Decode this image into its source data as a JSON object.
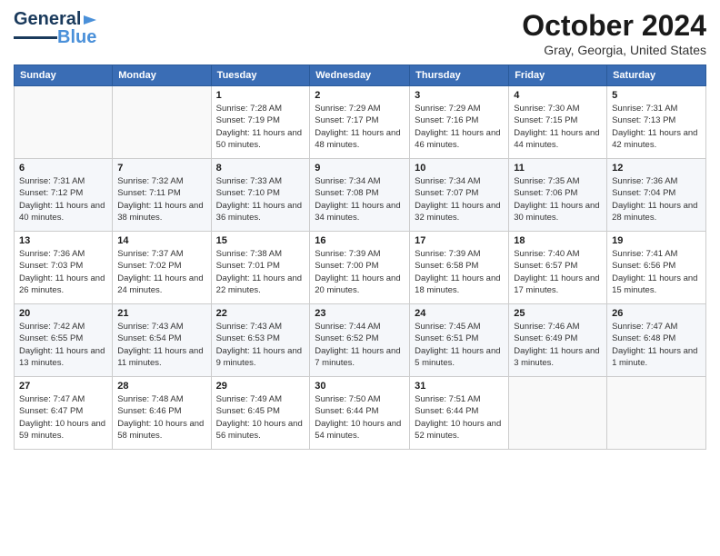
{
  "header": {
    "logo": {
      "line1": "General",
      "line2": "Blue"
    },
    "title": "October 2024",
    "location": "Gray, Georgia, United States"
  },
  "weekdays": [
    "Sunday",
    "Monday",
    "Tuesday",
    "Wednesday",
    "Thursday",
    "Friday",
    "Saturday"
  ],
  "weeks": [
    [
      {
        "day": "",
        "sunrise": "",
        "sunset": "",
        "daylight": ""
      },
      {
        "day": "",
        "sunrise": "",
        "sunset": "",
        "daylight": ""
      },
      {
        "day": "1",
        "sunrise": "Sunrise: 7:28 AM",
        "sunset": "Sunset: 7:19 PM",
        "daylight": "Daylight: 11 hours and 50 minutes."
      },
      {
        "day": "2",
        "sunrise": "Sunrise: 7:29 AM",
        "sunset": "Sunset: 7:17 PM",
        "daylight": "Daylight: 11 hours and 48 minutes."
      },
      {
        "day": "3",
        "sunrise": "Sunrise: 7:29 AM",
        "sunset": "Sunset: 7:16 PM",
        "daylight": "Daylight: 11 hours and 46 minutes."
      },
      {
        "day": "4",
        "sunrise": "Sunrise: 7:30 AM",
        "sunset": "Sunset: 7:15 PM",
        "daylight": "Daylight: 11 hours and 44 minutes."
      },
      {
        "day": "5",
        "sunrise": "Sunrise: 7:31 AM",
        "sunset": "Sunset: 7:13 PM",
        "daylight": "Daylight: 11 hours and 42 minutes."
      }
    ],
    [
      {
        "day": "6",
        "sunrise": "Sunrise: 7:31 AM",
        "sunset": "Sunset: 7:12 PM",
        "daylight": "Daylight: 11 hours and 40 minutes."
      },
      {
        "day": "7",
        "sunrise": "Sunrise: 7:32 AM",
        "sunset": "Sunset: 7:11 PM",
        "daylight": "Daylight: 11 hours and 38 minutes."
      },
      {
        "day": "8",
        "sunrise": "Sunrise: 7:33 AM",
        "sunset": "Sunset: 7:10 PM",
        "daylight": "Daylight: 11 hours and 36 minutes."
      },
      {
        "day": "9",
        "sunrise": "Sunrise: 7:34 AM",
        "sunset": "Sunset: 7:08 PM",
        "daylight": "Daylight: 11 hours and 34 minutes."
      },
      {
        "day": "10",
        "sunrise": "Sunrise: 7:34 AM",
        "sunset": "Sunset: 7:07 PM",
        "daylight": "Daylight: 11 hours and 32 minutes."
      },
      {
        "day": "11",
        "sunrise": "Sunrise: 7:35 AM",
        "sunset": "Sunset: 7:06 PM",
        "daylight": "Daylight: 11 hours and 30 minutes."
      },
      {
        "day": "12",
        "sunrise": "Sunrise: 7:36 AM",
        "sunset": "Sunset: 7:04 PM",
        "daylight": "Daylight: 11 hours and 28 minutes."
      }
    ],
    [
      {
        "day": "13",
        "sunrise": "Sunrise: 7:36 AM",
        "sunset": "Sunset: 7:03 PM",
        "daylight": "Daylight: 11 hours and 26 minutes."
      },
      {
        "day": "14",
        "sunrise": "Sunrise: 7:37 AM",
        "sunset": "Sunset: 7:02 PM",
        "daylight": "Daylight: 11 hours and 24 minutes."
      },
      {
        "day": "15",
        "sunrise": "Sunrise: 7:38 AM",
        "sunset": "Sunset: 7:01 PM",
        "daylight": "Daylight: 11 hours and 22 minutes."
      },
      {
        "day": "16",
        "sunrise": "Sunrise: 7:39 AM",
        "sunset": "Sunset: 7:00 PM",
        "daylight": "Daylight: 11 hours and 20 minutes."
      },
      {
        "day": "17",
        "sunrise": "Sunrise: 7:39 AM",
        "sunset": "Sunset: 6:58 PM",
        "daylight": "Daylight: 11 hours and 18 minutes."
      },
      {
        "day": "18",
        "sunrise": "Sunrise: 7:40 AM",
        "sunset": "Sunset: 6:57 PM",
        "daylight": "Daylight: 11 hours and 17 minutes."
      },
      {
        "day": "19",
        "sunrise": "Sunrise: 7:41 AM",
        "sunset": "Sunset: 6:56 PM",
        "daylight": "Daylight: 11 hours and 15 minutes."
      }
    ],
    [
      {
        "day": "20",
        "sunrise": "Sunrise: 7:42 AM",
        "sunset": "Sunset: 6:55 PM",
        "daylight": "Daylight: 11 hours and 13 minutes."
      },
      {
        "day": "21",
        "sunrise": "Sunrise: 7:43 AM",
        "sunset": "Sunset: 6:54 PM",
        "daylight": "Daylight: 11 hours and 11 minutes."
      },
      {
        "day": "22",
        "sunrise": "Sunrise: 7:43 AM",
        "sunset": "Sunset: 6:53 PM",
        "daylight": "Daylight: 11 hours and 9 minutes."
      },
      {
        "day": "23",
        "sunrise": "Sunrise: 7:44 AM",
        "sunset": "Sunset: 6:52 PM",
        "daylight": "Daylight: 11 hours and 7 minutes."
      },
      {
        "day": "24",
        "sunrise": "Sunrise: 7:45 AM",
        "sunset": "Sunset: 6:51 PM",
        "daylight": "Daylight: 11 hours and 5 minutes."
      },
      {
        "day": "25",
        "sunrise": "Sunrise: 7:46 AM",
        "sunset": "Sunset: 6:49 PM",
        "daylight": "Daylight: 11 hours and 3 minutes."
      },
      {
        "day": "26",
        "sunrise": "Sunrise: 7:47 AM",
        "sunset": "Sunset: 6:48 PM",
        "daylight": "Daylight: 11 hours and 1 minute."
      }
    ],
    [
      {
        "day": "27",
        "sunrise": "Sunrise: 7:47 AM",
        "sunset": "Sunset: 6:47 PM",
        "daylight": "Daylight: 10 hours and 59 minutes."
      },
      {
        "day": "28",
        "sunrise": "Sunrise: 7:48 AM",
        "sunset": "Sunset: 6:46 PM",
        "daylight": "Daylight: 10 hours and 58 minutes."
      },
      {
        "day": "29",
        "sunrise": "Sunrise: 7:49 AM",
        "sunset": "Sunset: 6:45 PM",
        "daylight": "Daylight: 10 hours and 56 minutes."
      },
      {
        "day": "30",
        "sunrise": "Sunrise: 7:50 AM",
        "sunset": "Sunset: 6:44 PM",
        "daylight": "Daylight: 10 hours and 54 minutes."
      },
      {
        "day": "31",
        "sunrise": "Sunrise: 7:51 AM",
        "sunset": "Sunset: 6:44 PM",
        "daylight": "Daylight: 10 hours and 52 minutes."
      },
      {
        "day": "",
        "sunrise": "",
        "sunset": "",
        "daylight": ""
      },
      {
        "day": "",
        "sunrise": "",
        "sunset": "",
        "daylight": ""
      }
    ]
  ]
}
